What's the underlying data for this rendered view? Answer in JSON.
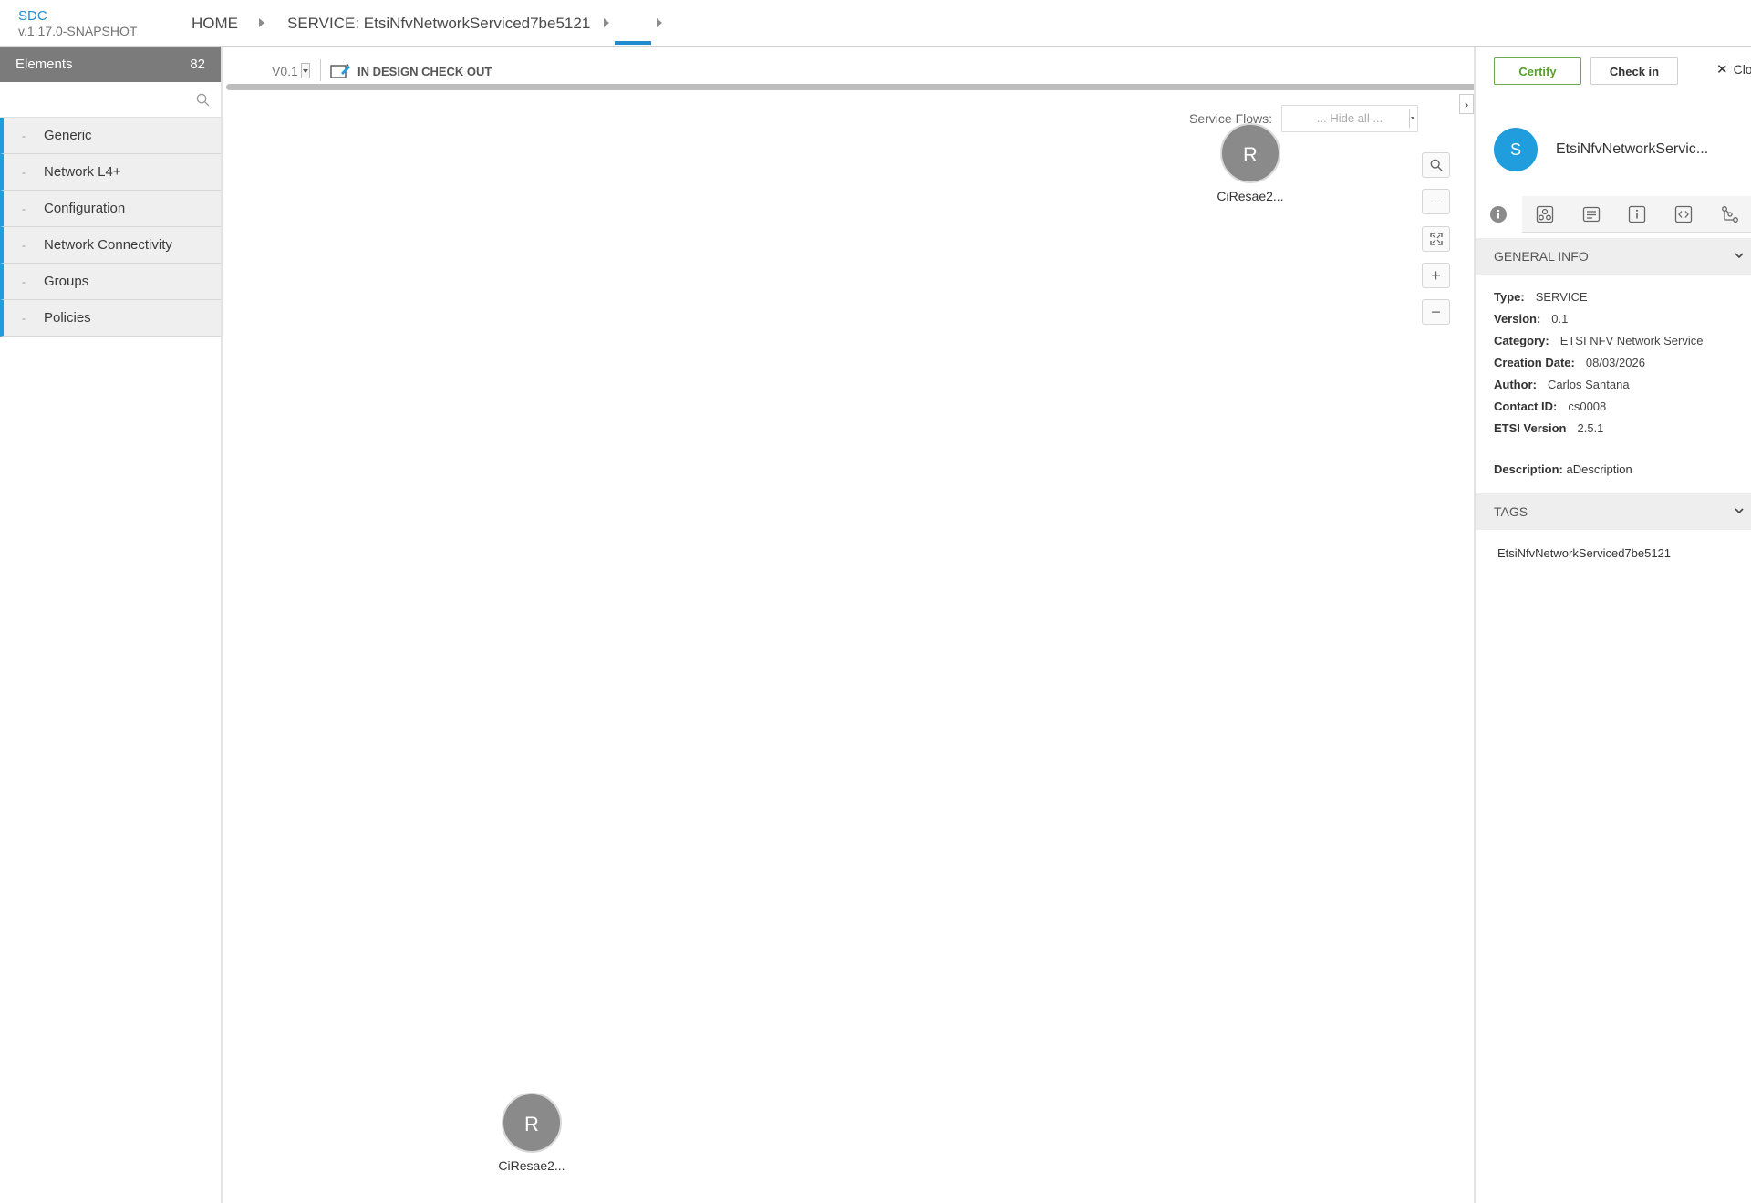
{
  "app": {
    "name": "SDC",
    "version": "v.1.17.0-SNAPSHOT"
  },
  "breadcrumb": {
    "home": "HOME",
    "service": "SERVICE: EtsiNfvNetworkServiced7be5121"
  },
  "palette": {
    "title": "Elements",
    "count": "82",
    "search_placeholder": "",
    "groups": [
      {
        "label": "Generic"
      },
      {
        "label": "Network L4+"
      },
      {
        "label": "Configuration"
      },
      {
        "label": "Network Connectivity"
      },
      {
        "label": "Groups"
      },
      {
        "label": "Policies"
      }
    ]
  },
  "toolbar": {
    "version": "V0.1",
    "status": "IN DESIGN CHECK OUT",
    "certify": "Certify",
    "checkin": "Check in",
    "close": "Clo"
  },
  "canvas": {
    "flows_label": "Service Flows:",
    "flows_value": "... Hide all ...",
    "nodes": [
      {
        "initial": "R",
        "label": "CiResae2..."
      },
      {
        "initial": "R",
        "label": "CiResae2..."
      }
    ]
  },
  "details": {
    "initial": "S",
    "name": "EtsiNfvNetworkServic...",
    "general_info_title": "GENERAL INFO",
    "fields": [
      {
        "key": "Type:",
        "value": "SERVICE"
      },
      {
        "key": "Version:",
        "value": "0.1"
      },
      {
        "key": "Category:",
        "value": "ETSI NFV Network Service"
      },
      {
        "key": "Creation Date:",
        "value": "08/03/2026"
      },
      {
        "key": "Author:",
        "value": "Carlos Santana"
      },
      {
        "key": "Contact ID:",
        "value": "cs0008"
      },
      {
        "key": "ETSI Version",
        "value": "2.5.1"
      }
    ],
    "description_key": "Description:",
    "description_value": "aDescription",
    "tags_title": "TAGS",
    "tags": [
      "EtsiNfvNetworkServiced7be5121"
    ]
  },
  "colors": {
    "accent": "#1f9ddc",
    "certify": "#5aa02c",
    "node": "#8a8a8a",
    "palette_header": "#7b7b7b"
  }
}
